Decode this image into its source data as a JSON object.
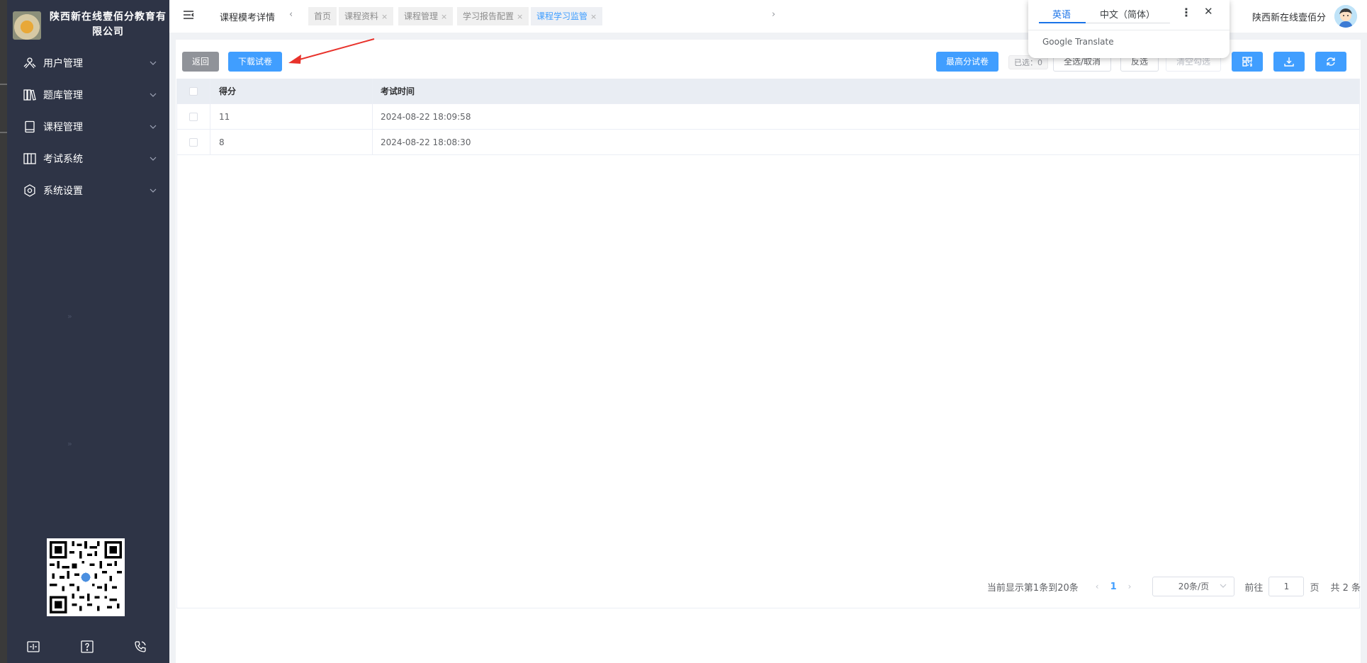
{
  "sidebar": {
    "brand": "陕西新在线壹佰分教育有限公司",
    "items": [
      {
        "label": "用户管理",
        "icon": "users-icon"
      },
      {
        "label": "题库管理",
        "icon": "library-icon"
      },
      {
        "label": "课程管理",
        "icon": "book-icon"
      },
      {
        "label": "考试系统",
        "icon": "exam-icon"
      },
      {
        "label": "系统设置",
        "icon": "gear-icon"
      }
    ],
    "watermark": "»"
  },
  "header": {
    "page_title": "课程模考详情",
    "tabs": [
      {
        "label": "首页",
        "closable": false
      },
      {
        "label": "课程资料",
        "closable": true
      },
      {
        "label": "课程管理",
        "closable": true
      },
      {
        "label": "学习报告配置",
        "closable": true
      },
      {
        "label": "课程学习监管",
        "closable": true,
        "active": true
      }
    ],
    "tab_close": "×",
    "user_name": "陕西新在线壹佰分"
  },
  "translate_popup": {
    "lang_a": "英语",
    "lang_b": "中文（简体）",
    "brand": "Google Translate"
  },
  "toolbar": {
    "back_label": "返回",
    "download_paper_label": "下载试卷",
    "top_score_label": "最高分试卷",
    "selected_label": "已选：0",
    "select_all_label": "全选/取消",
    "invert_label": "反选",
    "clear_label": "清空勾选"
  },
  "table": {
    "columns": [
      "得分",
      "考试时间"
    ],
    "rows": [
      {
        "score": "11",
        "time": "2024-08-22 18:09:58"
      },
      {
        "score": "8",
        "time": "2024-08-22 18:08:30"
      }
    ]
  },
  "pagination": {
    "range_text": "当前显示第1条到20条",
    "current_page": "1",
    "page_size": "20条/页",
    "goto_label": "前往",
    "goto_value": "1",
    "page_unit": "页",
    "total_text": "共 2 条"
  },
  "colors": {
    "sidebar_bg": "#2e3446",
    "primary": "#409eff",
    "annotation_arrow": "#e8322b"
  }
}
